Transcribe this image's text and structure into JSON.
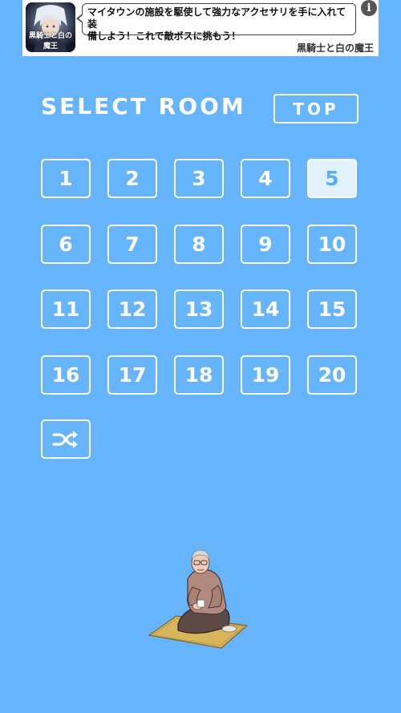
{
  "ad": {
    "thumbnail_title": "黒騎士と白の魔王",
    "message_line1": "マイタウンの施設を駆使して強力なアクセサリを手に入れて装",
    "message_line2": "備しよう！これで敵ボスに挑もう！",
    "game_name": "黒騎士と白の魔王",
    "info_label": "i"
  },
  "header": {
    "title": "SELECT ROOM",
    "top_label": "TOP"
  },
  "rooms": [
    "1",
    "2",
    "3",
    "4",
    "5",
    "6",
    "7",
    "8",
    "9",
    "10",
    "11",
    "12",
    "13",
    "14",
    "15",
    "16",
    "17",
    "18",
    "19",
    "20"
  ],
  "selected_room": "5",
  "shuffle": {
    "icon": "shuffle-icon"
  },
  "colors": {
    "background": "#66b5fc",
    "button_border": "#ffffff",
    "selected_fill": "#e2f1fe",
    "selected_text": "#59acf5"
  }
}
